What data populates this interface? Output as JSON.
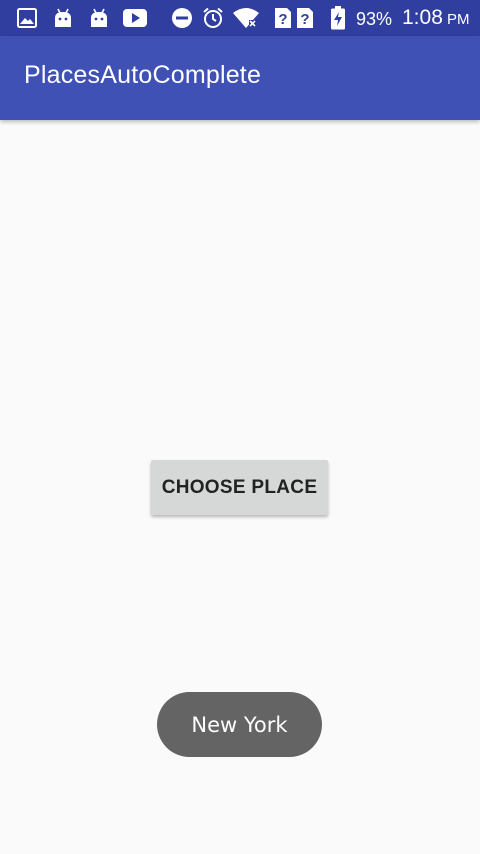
{
  "status_bar": {
    "icons": [
      "image-icon",
      "android-icon",
      "android-icon",
      "youtube-icon",
      "do-not-disturb-icon",
      "alarm-icon",
      "wifi-icon",
      "no-sim-icon",
      "no-sim-icon",
      "battery-charging-icon"
    ],
    "battery_percent": "93%",
    "time": "1:08",
    "ampm": "PM"
  },
  "app_bar": {
    "title": "PlacesAutoComplete"
  },
  "main": {
    "choose_place_label": "CHOOSE PLACE"
  },
  "toast": {
    "text": "New York"
  },
  "colors": {
    "status_bar": "#303f9f",
    "app_bar": "#3f51b5",
    "background": "#fafafa",
    "button": "#d6d7d7",
    "toast": "#646464"
  }
}
